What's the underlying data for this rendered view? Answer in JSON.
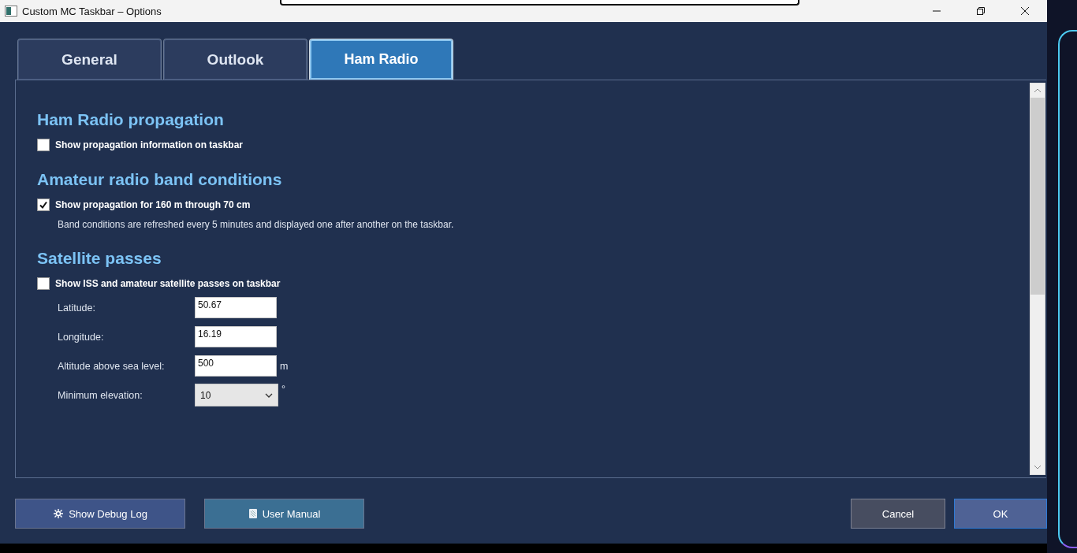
{
  "window": {
    "title": "Custom MC Taskbar – Options"
  },
  "tabs": [
    {
      "label": "General",
      "selected": false
    },
    {
      "label": "Outlook",
      "selected": false
    },
    {
      "label": "Ham Radio",
      "selected": true
    }
  ],
  "sections": [
    {
      "heading": "Ham Radio propagation",
      "checkbox": {
        "label": "Show propagation information on taskbar",
        "checked": false
      }
    },
    {
      "heading": "Amateur radio band conditions",
      "checkbox": {
        "label": "Show propagation for 160 m through 70 cm",
        "checked": true
      },
      "note": "Band conditions are refreshed every 5 minutes and displayed one after another on the taskbar."
    },
    {
      "heading": "Satellite passes",
      "checkbox": {
        "label": "Show ISS and amateur satellite passes on taskbar",
        "checked": false
      },
      "fields": [
        {
          "kind": "text",
          "label": "Latitude:",
          "value": "50.67"
        },
        {
          "kind": "text",
          "label": "Longitude:",
          "value": "16.19"
        },
        {
          "kind": "text",
          "label": "Altitude above sea level:",
          "value": "500",
          "unit": "m"
        },
        {
          "kind": "dropdown",
          "label": "Minimum elevation:",
          "value": "10",
          "unit": "°"
        }
      ]
    }
  ],
  "buttons_left": [
    {
      "kind": "debug",
      "label": "Show Debug Log"
    },
    {
      "kind": "manual",
      "label": "User Manual"
    }
  ],
  "buttons_right": [
    {
      "kind": "cancel",
      "label": "Cancel"
    },
    {
      "kind": "ok",
      "label": "OK"
    }
  ]
}
